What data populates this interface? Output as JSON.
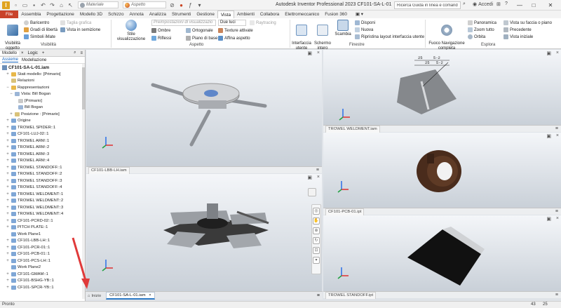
{
  "titlebar": {
    "app_icon_letter": "I",
    "material_placeholder": "Materiale",
    "appearance_placeholder": "Aspetto",
    "window_title": "Autodesk Inventor Professional 2023   CF101-SA-L-01",
    "help_search": "Ricerca Guida in linea e comand",
    "signin": "Accedi",
    "minimize": "—",
    "maximize": "□",
    "close": "✕"
  },
  "tabs": [
    "File",
    "Assembla",
    "Progettazione",
    "Modello 3D",
    "Schizzo",
    "Annota",
    "Analizza",
    "Strumenti",
    "Gestione",
    "Vista",
    "Ambienti",
    "Collabora",
    "Elettromeccanico",
    "Fusion 360"
  ],
  "ribbon": {
    "visibility": {
      "big_label": "Visibilità\noggetto",
      "baricentro": "Baricentro",
      "gradi_liberta": "Gradi di libertà",
      "simboli_imate": "Simboli iMate",
      "taglia_grafica": "Taglia grafica",
      "vista_seminazione": "Vista in semizione",
      "group": "Visibilità"
    },
    "aspetto": {
      "stile_label": "Stile visualizzazione",
      "preset_placeholder": "Preimpostazioni di visualizzazio",
      "luci": "Due luci",
      "raytracing": "Raytracing",
      "ombre": "Ombre",
      "ortogonale": "Ortogonale",
      "texture": "Texture attivate",
      "riflessi": "Riflessi",
      "piano_base": "Piano di base",
      "affina": "Affina aspetto",
      "group": "Aspetto"
    },
    "finestre": {
      "interfaccia": "Interfaccia\nutente",
      "schermo": "Schermo\nintero",
      "scambia": "Scambia",
      "disponi": "Disponi",
      "nuova": "Nuova",
      "ripristina": "Ripristina layout interfaccia utente",
      "group": "Finestre"
    },
    "esplora": {
      "focoso": "Fuoco Navigazione\ncompleta",
      "panoramica": "Panoramica",
      "zoom": "Zoom tutto",
      "orbita": "Orbita",
      "vista_faccia": "Vista su faccia o piano",
      "precedente": "Precedente",
      "vista_iniziale": "Vista iniziale",
      "group": "Esplora"
    }
  },
  "browser": {
    "tabs": [
      "Modello",
      "Logic",
      "+"
    ],
    "subtabs": [
      "Assieme",
      "Modellazione"
    ],
    "root": "CF101-SA-L-01.iam",
    "items": [
      {
        "label": "Stati modello: [Primario]",
        "indent": 1,
        "expand": "+"
      },
      {
        "label": "Relazioni",
        "indent": 1,
        "expand": ""
      },
      {
        "label": "Rappresentazioni",
        "indent": 1,
        "expand": "−"
      },
      {
        "label": "Vista: Bill Bogan",
        "indent": 2,
        "expand": "−"
      },
      {
        "label": "[Primario]",
        "indent": 3,
        "expand": ""
      },
      {
        "label": "Bill Bogan",
        "indent": 3,
        "expand": ""
      },
      {
        "label": "Posizione : [Primario]",
        "indent": 2,
        "expand": "+"
      },
      {
        "label": "Origine",
        "indent": 1,
        "expand": "+"
      },
      {
        "label": "TROWEL SPIDER::1",
        "indent": 1,
        "expand": "+"
      },
      {
        "label": "CF101-LUJ-02::1",
        "indent": 1,
        "expand": "+"
      },
      {
        "label": "TROWEL ARM::1",
        "indent": 1,
        "expand": "+"
      },
      {
        "label": "TROWEL ARM::2",
        "indent": 1,
        "expand": "+"
      },
      {
        "label": "TROWEL ARM::3",
        "indent": 1,
        "expand": "+"
      },
      {
        "label": "TROWEL ARM::4",
        "indent": 1,
        "expand": "+"
      },
      {
        "label": "TROWEL STANDOFF::1",
        "indent": 1,
        "expand": "+"
      },
      {
        "label": "TROWEL STANDOFF::2",
        "indent": 1,
        "expand": "+"
      },
      {
        "label": "TROWEL STANDOFF::3",
        "indent": 1,
        "expand": "+"
      },
      {
        "label": "TROWEL STANDOFF::4",
        "indent": 1,
        "expand": "+"
      },
      {
        "label": "TROWEL WELDMENT::1",
        "indent": 1,
        "expand": "+"
      },
      {
        "label": "TROWEL WELDMENT::2",
        "indent": 1,
        "expand": "+"
      },
      {
        "label": "TROWEL WELDMENT::3",
        "indent": 1,
        "expand": "+"
      },
      {
        "label": "TROWEL WELDMENT::4",
        "indent": 1,
        "expand": "+"
      },
      {
        "label": "CF101-PCRD-02::1",
        "indent": 1,
        "expand": "+"
      },
      {
        "label": "PITCH PLATE::1",
        "indent": 1,
        "expand": "+"
      },
      {
        "label": "Work Plane1",
        "indent": 1,
        "expand": ""
      },
      {
        "label": "CF101-LBB-LH::1",
        "indent": 1,
        "expand": "+"
      },
      {
        "label": "CF101-PCR-01::1",
        "indent": 1,
        "expand": "+"
      },
      {
        "label": "CF101-PCB-01::1",
        "indent": 1,
        "expand": "+"
      },
      {
        "label": "CF101-PCS-LH::1",
        "indent": 1,
        "expand": "+"
      },
      {
        "label": "Work Plane2",
        "indent": 1,
        "expand": ""
      },
      {
        "label": "CF101-GMAM::1",
        "indent": 1,
        "expand": "+"
      },
      {
        "label": "CF101-BSHG-YB::1",
        "indent": 1,
        "expand": "+"
      },
      {
        "label": "CF101-SPCR-YB::1",
        "indent": 1,
        "expand": "+"
      }
    ]
  },
  "viewports": {
    "top_left": "CF101-LBB-LH.iam",
    "mid_right": "TROWEL WELDMENT.iam",
    "lower_right": "CF101-PCB-01.ipt",
    "bottom_right": "TROWEL STANDOFF.ipt"
  },
  "doctabs": {
    "home": "Inizio",
    "current": "CF101-SA-L-01.iam"
  },
  "drawing_annotation": {
    "a": "25",
    "b": "5-2",
    "c": "25",
    "d": "5-2"
  },
  "status": {
    "text": "Pronto",
    "a": "43",
    "b": "25"
  },
  "colors": {
    "file_tab": "#c9422a",
    "accent": "#2b78c5",
    "arrow": "#e03a3a"
  }
}
